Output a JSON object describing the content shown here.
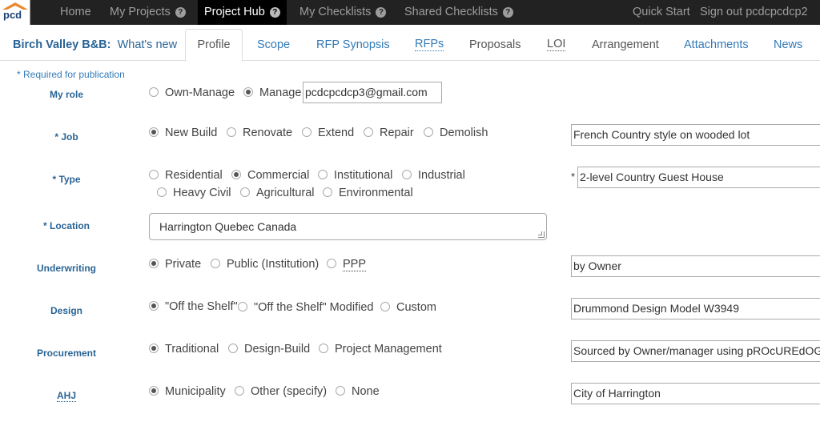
{
  "topbar": {
    "logo_text": "pcd",
    "nav": [
      {
        "label": "Home"
      },
      {
        "label": "My Projects",
        "help": "?"
      },
      {
        "label": "Project Hub",
        "help": "?"
      },
      {
        "label": "My Checklists",
        "help": "?"
      },
      {
        "label": "Shared Checklists",
        "help": "?"
      }
    ],
    "quick_start": "Quick Start",
    "sign_out": "Sign out pcdcpcdcp2"
  },
  "project": {
    "name": "Birch Valley B&B:",
    "whats_new": "What's new"
  },
  "tabs": [
    {
      "label": "Profile"
    },
    {
      "label": "Scope"
    },
    {
      "label": "RFP Synopsis"
    },
    {
      "label": "RFPs"
    },
    {
      "label": "Proposals"
    },
    {
      "label": "LOI"
    },
    {
      "label": "Arrangement"
    },
    {
      "label": "Attachments"
    },
    {
      "label": "News"
    }
  ],
  "form": {
    "required_note": "* Required for publication",
    "my_role": {
      "label": "My role",
      "options": [
        "Own-Manage",
        "Manage"
      ],
      "selected": "Manage",
      "email": "pcdcpcdcp3@gmail.com"
    },
    "job": {
      "label": "* Job",
      "options": [
        "New Build",
        "Renovate",
        "Extend",
        "Repair",
        "Demolish"
      ],
      "selected": "New Build",
      "detail": "French Country style on wooded lot"
    },
    "type": {
      "label": "* Type",
      "options": [
        "Residential",
        "Commercial",
        "Institutional",
        "Industrial",
        "Heavy Civil",
        "Agricultural",
        "Environmental"
      ],
      "selected": "Commercial",
      "detail_star": "*",
      "detail": "2-level Country Guest House"
    },
    "location": {
      "label": "* Location",
      "value": "Harrington  Quebec  Canada"
    },
    "underwriting": {
      "label": "Underwriting",
      "options": [
        "Private",
        "Public (Institution)",
        "PPP"
      ],
      "selected": "Private",
      "detail": "by Owner"
    },
    "design": {
      "label": "Design",
      "options": [
        "\"Off the Shelf\"",
        "\"Off the Shelf\" Modified",
        "Custom"
      ],
      "selected": "\"Off the Shelf\"",
      "detail": "Drummond Design Model W3949"
    },
    "procurement": {
      "label": "Procurement",
      "options": [
        "Traditional",
        "Design-Build",
        "Project Management"
      ],
      "selected": "Traditional",
      "detail": "Sourced by Owner/manager using pROcUREdOG"
    },
    "ahj": {
      "label": "AHJ",
      "options": [
        "Municipality",
        "Other (specify)",
        "None"
      ],
      "selected": "Municipality",
      "detail": "City of Harrington"
    }
  }
}
